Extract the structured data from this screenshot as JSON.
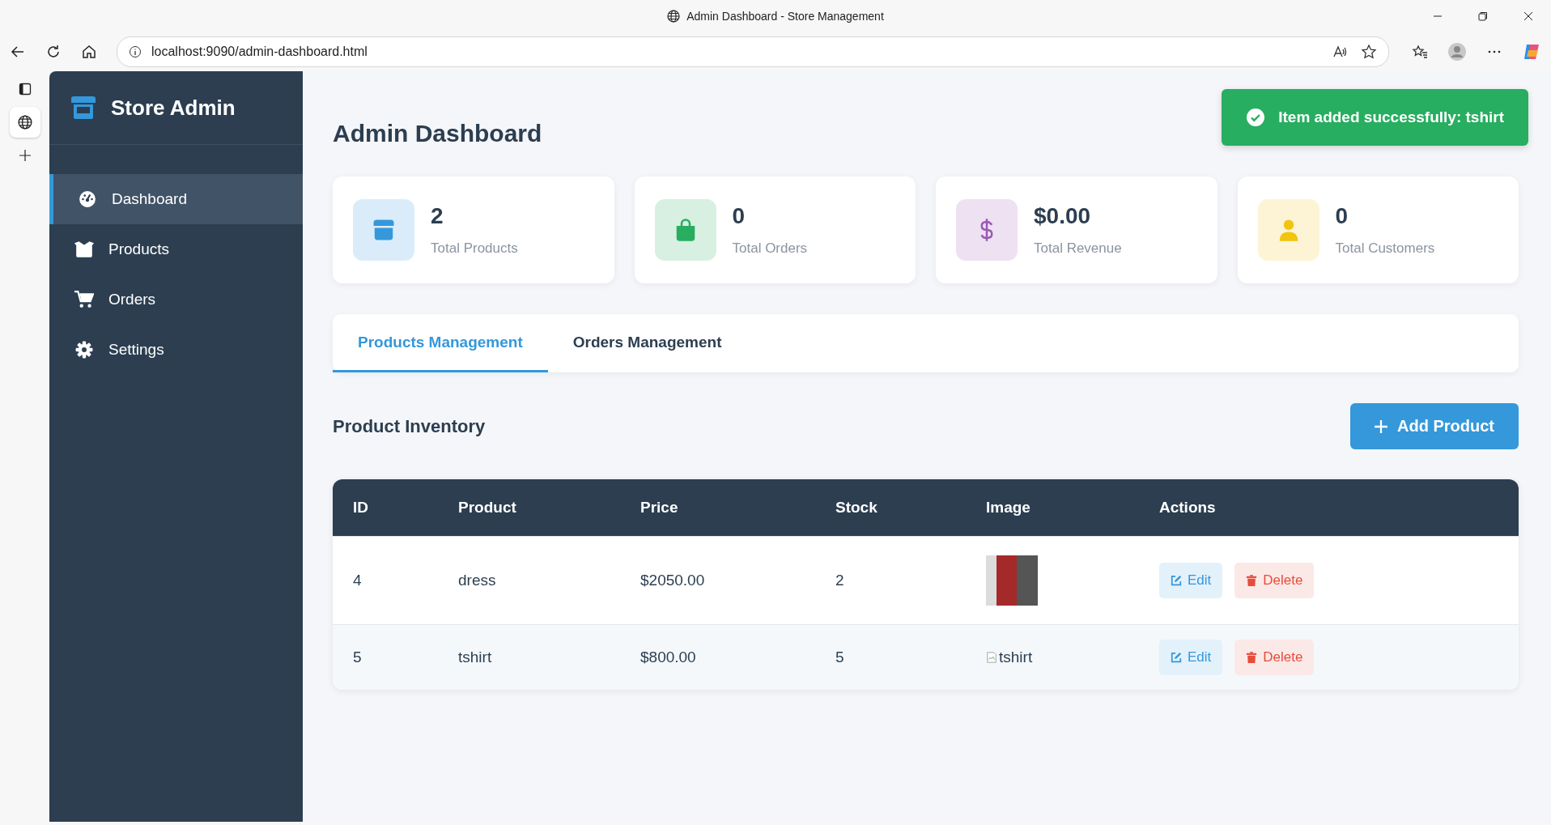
{
  "browser": {
    "title": "Admin Dashboard - Store Management",
    "url": "localhost:9090/admin-dashboard.html"
  },
  "sidebar": {
    "brand": "Store Admin",
    "items": [
      {
        "label": "Dashboard",
        "kind": "dashboard",
        "selected": true
      },
      {
        "label": "Products",
        "kind": "products",
        "selected": false
      },
      {
        "label": "Orders",
        "kind": "orders",
        "selected": false
      },
      {
        "label": "Settings",
        "kind": "settings",
        "selected": false
      }
    ]
  },
  "page": {
    "title": "Admin Dashboard"
  },
  "toast": {
    "message": "Item added successfully: tshirt"
  },
  "stats": [
    {
      "value": "2",
      "label": "Total Products",
      "kind": "products",
      "color": "#3498db"
    },
    {
      "value": "0",
      "label": "Total Orders",
      "kind": "orders",
      "color": "#27ae60"
    },
    {
      "value": "$0.00",
      "label": "Total Revenue",
      "kind": "revenue",
      "color": "#9b59b6"
    },
    {
      "value": "0",
      "label": "Total Customers",
      "kind": "customers",
      "color": "#f1c40f"
    }
  ],
  "tabs": [
    {
      "label": "Products Management",
      "selected": true
    },
    {
      "label": "Orders Management",
      "selected": false
    }
  ],
  "inventory": {
    "title": "Product Inventory",
    "add_button": "Add Product"
  },
  "table": {
    "columns": [
      "ID",
      "Product",
      "Price",
      "Stock",
      "Image",
      "Actions"
    ],
    "rows": [
      {
        "id": "4",
        "product": "dress",
        "price": "$2050.00",
        "stock": "2",
        "image": {
          "kind": "photo"
        },
        "edit": "Edit",
        "delete": "Delete",
        "hovered": false
      },
      {
        "id": "5",
        "product": "tshirt",
        "price": "$800.00",
        "stock": "5",
        "image": {
          "kind": "broken",
          "alt": "tshirt"
        },
        "edit": "Edit",
        "delete": "Delete",
        "hovered": true
      }
    ]
  }
}
